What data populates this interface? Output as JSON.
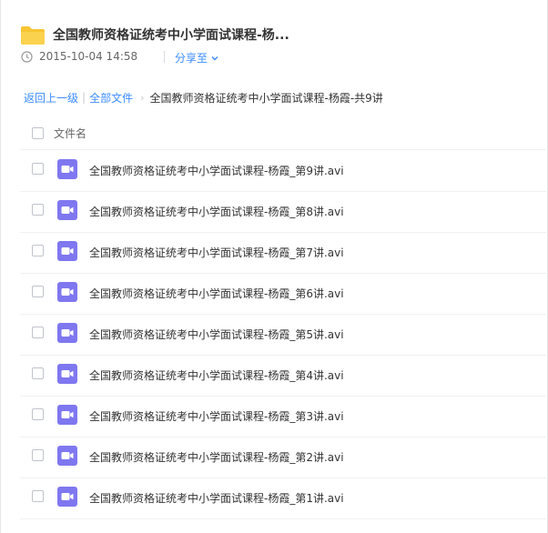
{
  "share": {
    "title": "全国教师资格证统考中小学面试课程-杨...",
    "date": "2015-10-04 14:58",
    "share_label": "分享至"
  },
  "breadcrumb": {
    "back": "返回上一级",
    "all_files": "全部文件",
    "current": "全国教师资格证统考中小学面试课程-杨霞-共9讲"
  },
  "list": {
    "column_name": "文件名",
    "files": [
      {
        "name": "全国教师资格证统考中小学面试课程-杨霞_第9讲.avi",
        "icon": "video-icon"
      },
      {
        "name": "全国教师资格证统考中小学面试课程-杨霞_第8讲.avi",
        "icon": "video-icon"
      },
      {
        "name": "全国教师资格证统考中小学面试课程-杨霞_第7讲.avi",
        "icon": "video-icon"
      },
      {
        "name": "全国教师资格证统考中小学面试课程-杨霞_第6讲.avi",
        "icon": "video-icon"
      },
      {
        "name": "全国教师资格证统考中小学面试课程-杨霞_第5讲.avi",
        "icon": "video-icon"
      },
      {
        "name": "全国教师资格证统考中小学面试课程-杨霞_第4讲.avi",
        "icon": "video-icon"
      },
      {
        "name": "全国教师资格证统考中小学面试课程-杨霞_第3讲.avi",
        "icon": "video-icon"
      },
      {
        "name": "全国教师资格证统考中小学面试课程-杨霞_第2讲.avi",
        "icon": "video-icon"
      },
      {
        "name": "全国教师资格证统考中小学面试课程-杨霞_第1讲.avi",
        "icon": "video-icon"
      }
    ]
  },
  "colors": {
    "link": "#3b8cff",
    "folder": "#f8c533",
    "video": "#7f77f0"
  }
}
